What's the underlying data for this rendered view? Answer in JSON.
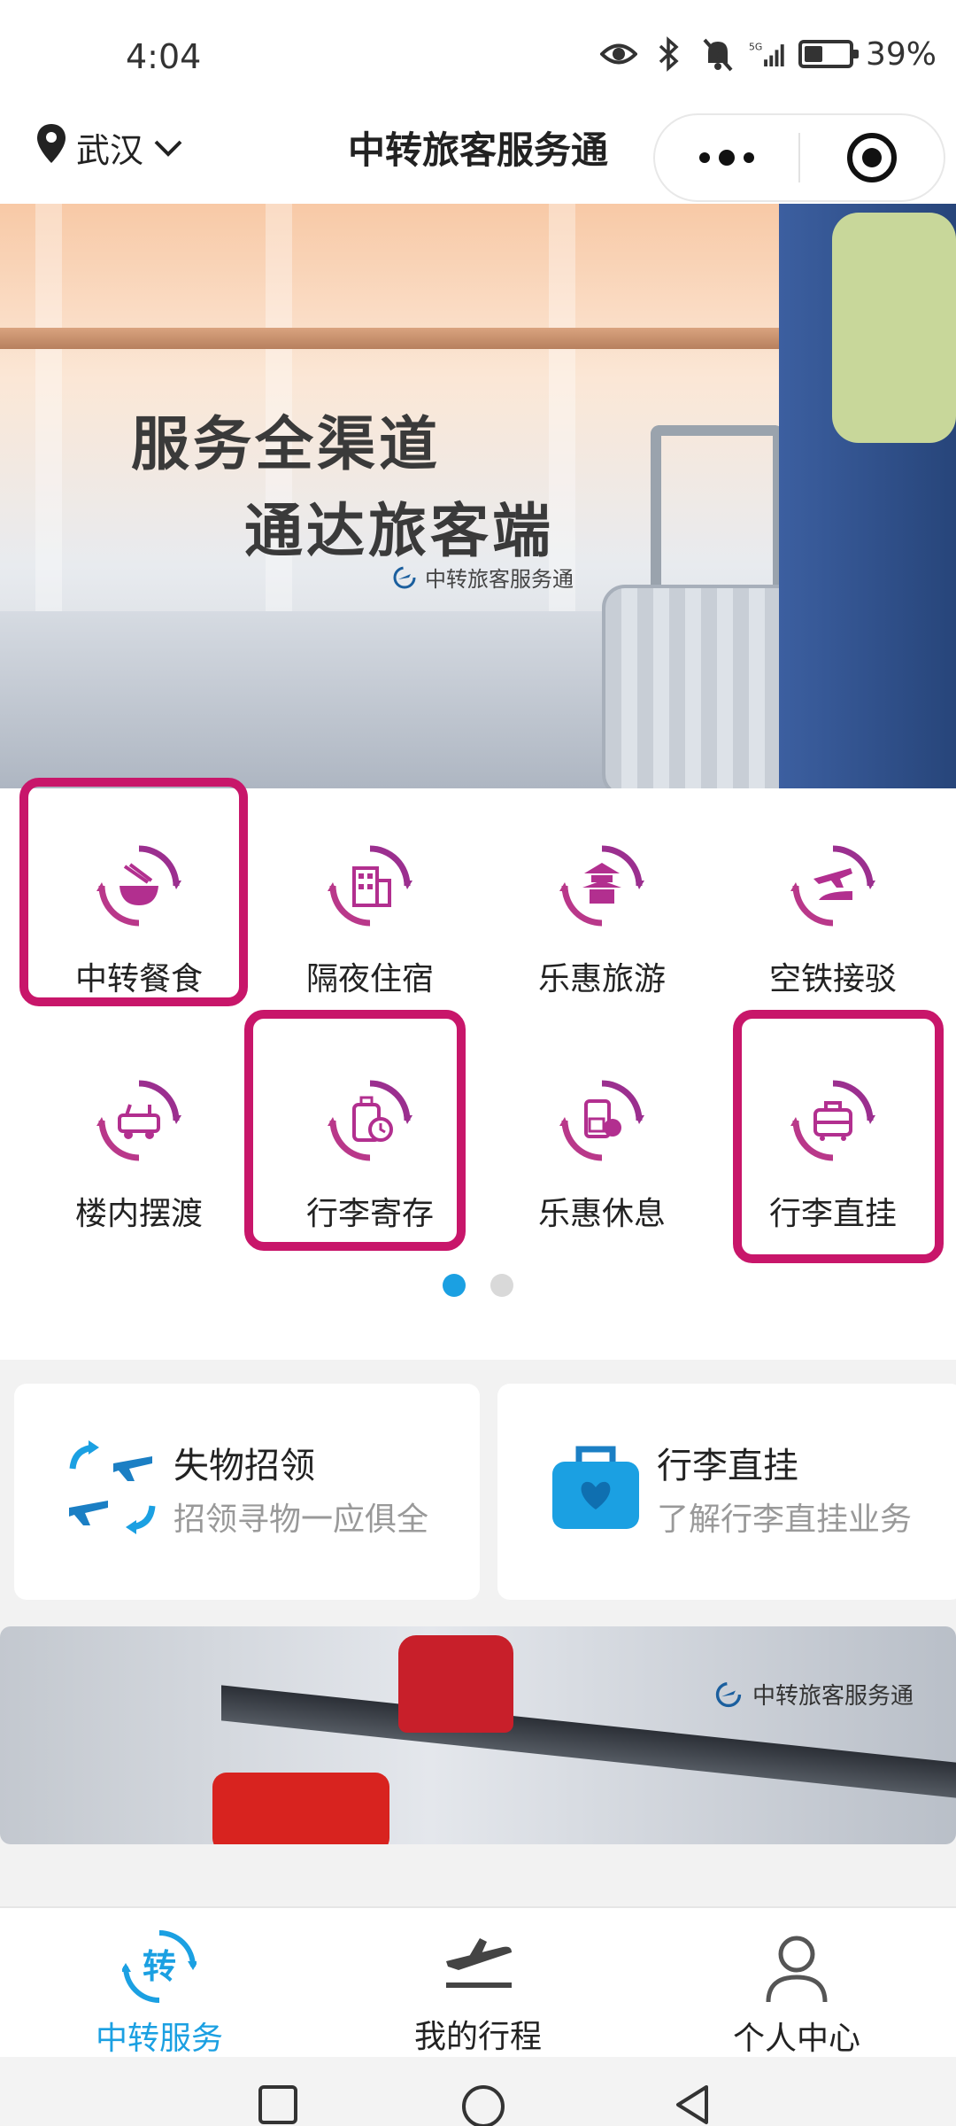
{
  "status_bar": {
    "time": "4:04",
    "network": "5G",
    "battery_percent": "39%",
    "battery_level": 0.39,
    "icons": [
      "eye-icon",
      "bluetooth-icon",
      "bell-off-icon",
      "signal-icon",
      "battery-icon"
    ]
  },
  "header": {
    "location": "武汉",
    "title": "中转旅客服务通"
  },
  "banner": {
    "slogan_line1": "服务全渠道",
    "slogan_line2": "通达旅客端",
    "brand": "中转旅客服务通"
  },
  "services": [
    {
      "label": "中转餐食",
      "icon": "noodle-bowl-icon",
      "highlighted": true
    },
    {
      "label": "隔夜住宿",
      "icon": "hotel-icon",
      "highlighted": false
    },
    {
      "label": "乐惠旅游",
      "icon": "pagoda-icon",
      "highlighted": false
    },
    {
      "label": "空铁接驳",
      "icon": "plane-train-icon",
      "highlighted": false
    },
    {
      "label": "楼内摆渡",
      "icon": "shuttle-cart-icon",
      "highlighted": false
    },
    {
      "label": "行李寄存",
      "icon": "luggage-clock-icon",
      "highlighted": true
    },
    {
      "label": "乐惠休息",
      "icon": "lounge-icon",
      "highlighted": false
    },
    {
      "label": "行李直挂",
      "icon": "luggage-icon",
      "highlighted": true
    }
  ],
  "highlight_color": "#c8166a",
  "accent_color": "#1ba0e2",
  "pager": {
    "pages": 2,
    "current": 1
  },
  "cards": [
    {
      "title": "失物招领",
      "subtitle": "招领寻物一应俱全",
      "icon": "lost-found-planes-icon"
    },
    {
      "title": "行李直挂",
      "subtitle": "了解行李直挂业务",
      "icon": "blue-bag-icon"
    }
  ],
  "bottom_banner": {
    "brand": "中转旅客服务通"
  },
  "tabs": [
    {
      "label": "中转服务",
      "icon": "transfer-icon",
      "icon_text": "转",
      "active": true
    },
    {
      "label": "我的行程",
      "icon": "departure-plane-icon",
      "active": false
    },
    {
      "label": "个人中心",
      "icon": "person-icon",
      "active": false
    }
  ],
  "nav_buttons": [
    "recent-apps-icon",
    "home-icon",
    "back-icon"
  ]
}
